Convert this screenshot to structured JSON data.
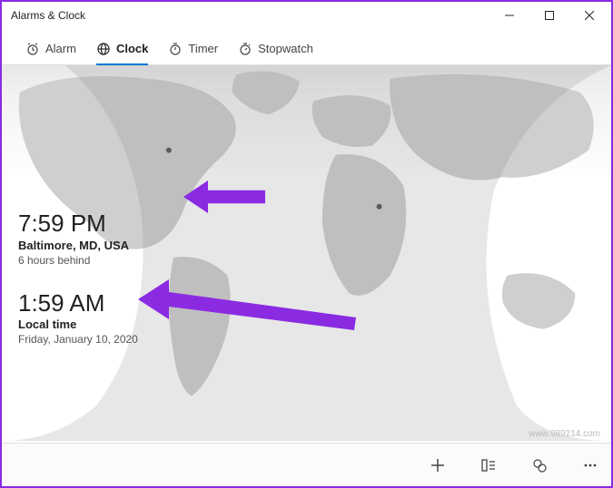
{
  "window": {
    "title": "Alarms & Clock"
  },
  "tabs": {
    "alarm": "Alarm",
    "clock": "Clock",
    "timer": "Timer",
    "stopwatch": "Stopwatch"
  },
  "clocks": {
    "remote": {
      "time": "7:59 PM",
      "location": "Baltimore, MD, USA",
      "offset": "6 hours behind"
    },
    "local": {
      "time": "1:59 AM",
      "location": "Local time",
      "date": "Friday, January 10, 2020"
    }
  },
  "watermark": "www.989214.com"
}
